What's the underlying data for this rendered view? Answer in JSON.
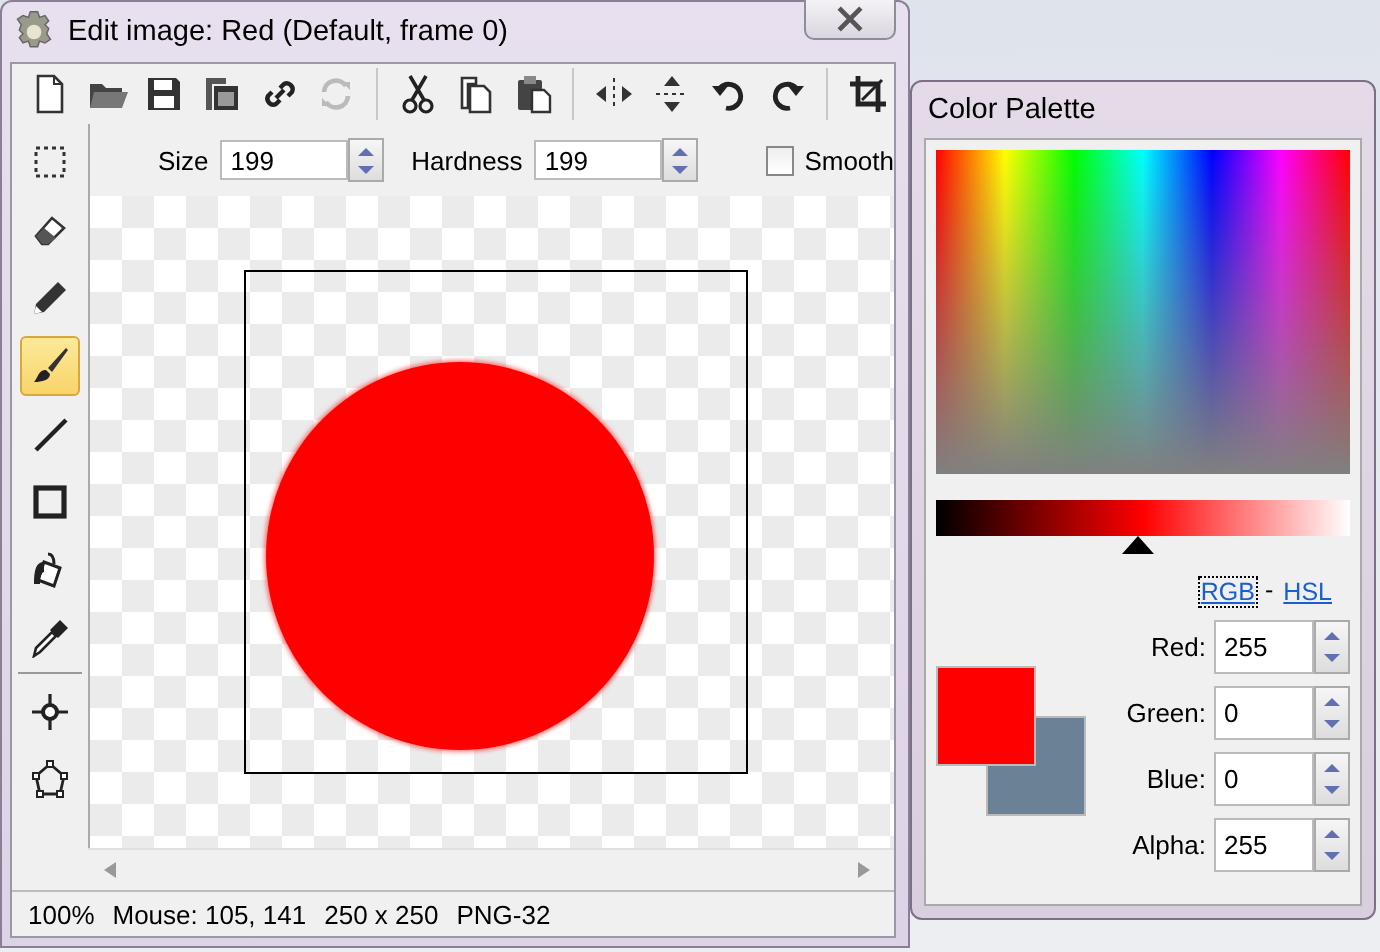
{
  "window": {
    "title": "Edit image: Red (Default, frame 0)"
  },
  "toolbar": [
    {
      "kind": "new",
      "disabled": false
    },
    {
      "kind": "open",
      "disabled": false
    },
    {
      "kind": "save",
      "disabled": false
    },
    {
      "kind": "save-copy",
      "disabled": false
    },
    {
      "kind": "link",
      "disabled": false
    },
    {
      "kind": "refresh",
      "disabled": true
    },
    {
      "kind": "sep"
    },
    {
      "kind": "cut",
      "disabled": false
    },
    {
      "kind": "copy",
      "disabled": false
    },
    {
      "kind": "paste",
      "disabled": false
    },
    {
      "kind": "sep"
    },
    {
      "kind": "flip-h",
      "disabled": false
    },
    {
      "kind": "flip-v",
      "disabled": false
    },
    {
      "kind": "rotate-left",
      "disabled": false
    },
    {
      "kind": "rotate-right",
      "disabled": false
    },
    {
      "kind": "sep"
    },
    {
      "kind": "crop",
      "disabled": false
    }
  ],
  "tools": [
    {
      "kind": "select",
      "selected": false
    },
    {
      "kind": "eraser",
      "selected": false
    },
    {
      "kind": "pencil",
      "selected": false
    },
    {
      "kind": "brush",
      "selected": true
    },
    {
      "kind": "line",
      "selected": false
    },
    {
      "kind": "rect",
      "selected": false
    },
    {
      "kind": "fill",
      "selected": false
    },
    {
      "kind": "picker",
      "selected": false
    },
    {
      "kind": "sep"
    },
    {
      "kind": "point",
      "selected": false
    },
    {
      "kind": "polygon",
      "selected": false
    }
  ],
  "options": {
    "size": {
      "label": "Size",
      "value": "199"
    },
    "hardness": {
      "label": "Hardness",
      "value": "199"
    },
    "smooth": {
      "label": "Smooth",
      "checked": false
    }
  },
  "status_bar": [
    "100%",
    "Mouse: 105, 141",
    "250 x 250",
    "PNG-32"
  ],
  "palette": {
    "title": "Color Palette",
    "shade": {
      "level": 0.49
    },
    "modes": [
      {
        "label": "RGB",
        "selected": true
      },
      {
        "label": "HSL",
        "selected": false
      }
    ],
    "separator": "-",
    "primary": {
      "color": "#ff0000"
    },
    "secondary": {
      "color": "#6a8196"
    },
    "fields": [
      {
        "label": "Red:",
        "value": "255"
      },
      {
        "label": "Green:",
        "value": "0"
      },
      {
        "label": "Blue:",
        "value": "0"
      },
      {
        "label": "Alpha:",
        "value": "255"
      }
    ]
  }
}
